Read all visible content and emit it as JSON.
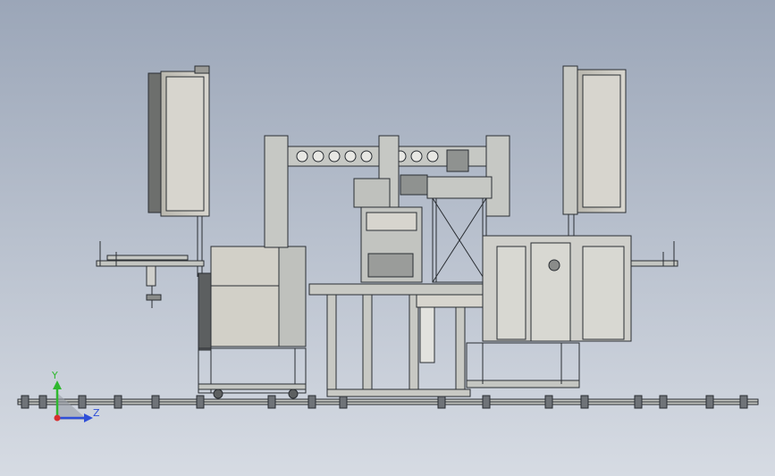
{
  "viewport": {
    "background_top": "#9ba6b8",
    "background_bottom": "#d6dbe3"
  },
  "model": {
    "line_color": "#2a2e33",
    "cabinet_fill": "#c9c6bc",
    "frame_fill": "#c2c4c0",
    "panel_fill": "#d7d5ce"
  },
  "triad": {
    "y_label": "Y",
    "z_label": "Z",
    "y_color": "#2fb82f",
    "z_color": "#2f4fd8",
    "x_color": "#d82f2f"
  }
}
